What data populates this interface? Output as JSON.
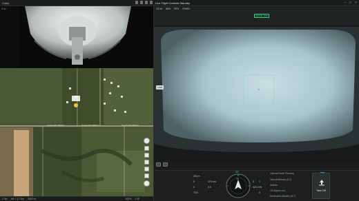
{
  "window": {
    "app_name": "Coley",
    "title": "Live Flight Controls Standby"
  },
  "camera": {
    "badge": "3.3x"
  },
  "main": {
    "status": [
      "1/2 M",
      "66%",
      "RTK",
      "FIXED"
    ],
    "mode": "MODE Cine",
    "side_tag": "Lock"
  },
  "map": {
    "road_label_1": "County Rd 2000 N",
    "road_label_2": "County Rd 2000 N",
    "road_label_3": "County Rd 2000 N"
  },
  "left_status": {
    "items": [
      "2.3m",
      "Alt: 1.17 Km",
      "3002 m"
    ],
    "right_items": [
      "100%",
      "1:10"
    ]
  },
  "telemetry": {
    "dist": "200 m",
    "hs": "0",
    "vs": "0",
    "alt": "0",
    "speed_label": "470 m/s",
    "speed_val": "0.0",
    "height_label": "420.0 rfs",
    "h_val": "0",
    "v_val": "0",
    "battery": "71%",
    "heading": "N",
    "pitch": "90°",
    "settings": [
      {
        "label": "Optimal Route Planning",
        "value": ""
      },
      {
        "label": "Takeoff Altitude (ALT)",
        "value": "40"
      },
      {
        "label": "Altitude",
        "value": "40"
      },
      {
        "label": "On Signal Lost",
        "value": "Return"
      },
      {
        "label": "Destination Altitude (ALT)",
        "value": "40"
      }
    ],
    "takeoff_label": "Take Off"
  },
  "colors": {
    "accent_green": "#3dd98c",
    "toggle_blue": "#2d8fe0"
  }
}
